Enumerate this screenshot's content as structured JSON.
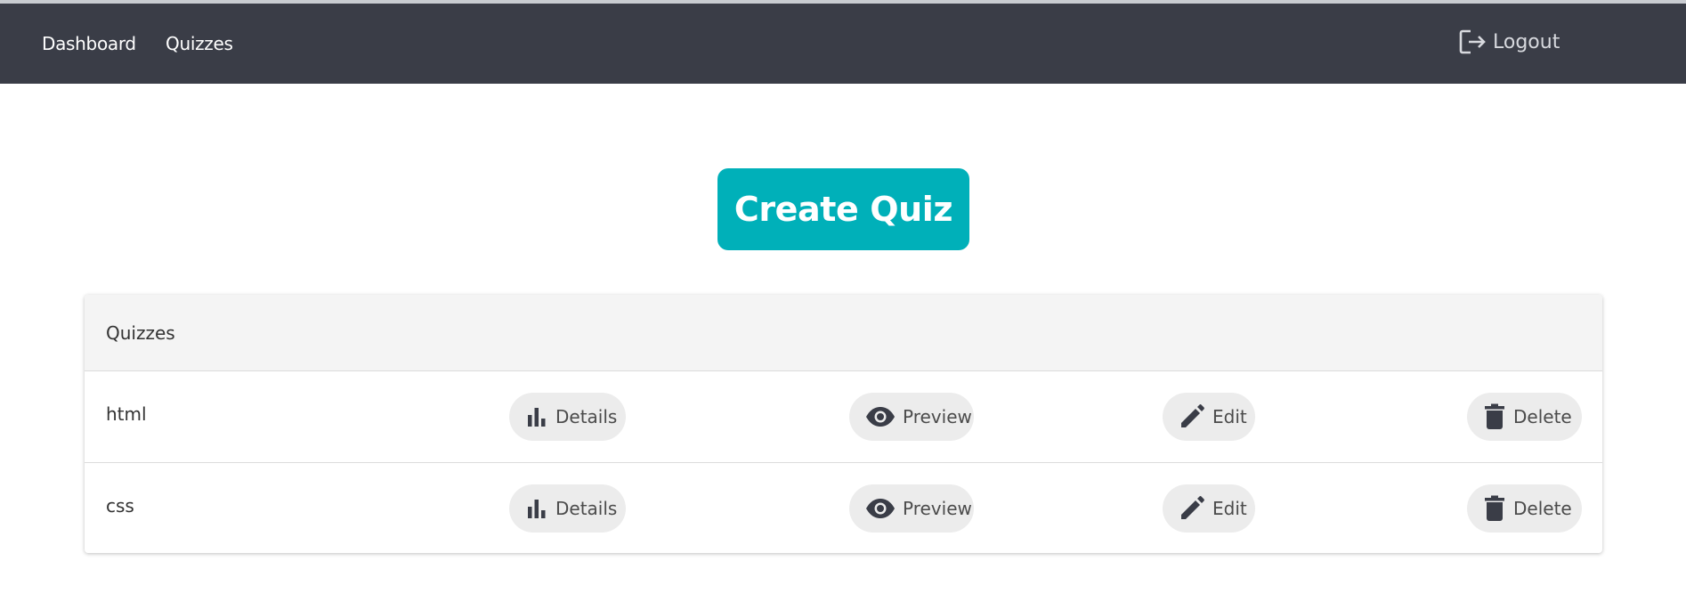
{
  "nav": {
    "dashboard": "Dashboard",
    "quizzes": "Quizzes",
    "logout": "Logout"
  },
  "main": {
    "create_quiz": "Create Quiz"
  },
  "table": {
    "header": "Quizzes",
    "rows": [
      {
        "name": "html",
        "details": "Details",
        "preview": "Preview",
        "edit": "Edit",
        "delete": "Delete"
      },
      {
        "name": "css",
        "details": "Details",
        "preview": "Preview",
        "edit": "Edit",
        "delete": "Delete"
      }
    ]
  },
  "colors": {
    "topbar": "#3a3d47",
    "accent": "#00b0b9",
    "action_bg": "#ececec"
  },
  "icons": {
    "logout": "logout-icon",
    "details": "bar-chart-icon",
    "preview": "eye-icon",
    "edit": "pencil-icon",
    "delete": "trash-icon"
  }
}
